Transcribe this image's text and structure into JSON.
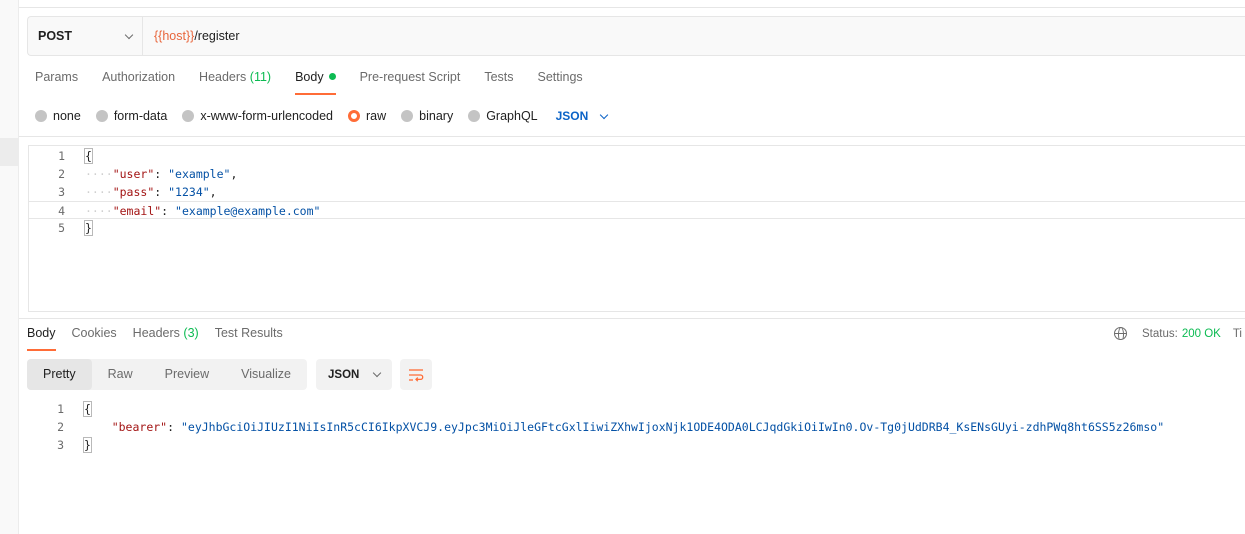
{
  "request": {
    "method": "POST",
    "url_variable": "{{host}}",
    "url_path": "/register",
    "tabs": [
      {
        "label": "Params"
      },
      {
        "label": "Authorization"
      },
      {
        "label": "Headers",
        "count": "(11)"
      },
      {
        "label": "Body"
      },
      {
        "label": "Pre-request Script"
      },
      {
        "label": "Tests"
      },
      {
        "label": "Settings"
      }
    ],
    "body_types": [
      "none",
      "form-data",
      "x-www-form-urlencoded",
      "raw",
      "binary",
      "GraphQL"
    ],
    "selected_body_type": "raw",
    "language": "JSON",
    "lines": {
      "n1": "1",
      "n2": "2",
      "n3": "3",
      "n4": "4",
      "n5": "5",
      "open": "{",
      "close": "}",
      "indent": "····",
      "k1": "\"user\"",
      "v1": "\"example\"",
      "k2": "\"pass\"",
      "v2": "\"1234\"",
      "k3": "\"email\"",
      "v3": "\"example@example.com\"",
      "colon": ":",
      "comma": ","
    }
  },
  "response": {
    "tabs": [
      {
        "label": "Body"
      },
      {
        "label": "Cookies"
      },
      {
        "label": "Headers",
        "count": "(3)"
      },
      {
        "label": "Test Results"
      }
    ],
    "status_label": "Status:",
    "status_value": "200 OK",
    "time_label": "Ti",
    "views": [
      "Pretty",
      "Raw",
      "Preview",
      "Visualize"
    ],
    "format": "JSON",
    "lines": {
      "n1": "1",
      "n2": "2",
      "n3": "3",
      "open": "{",
      "close": "}",
      "k1": "\"bearer\"",
      "v1": "\"eyJhbGciOiJIUzI1NiIsInR5cCI6IkpXVCJ9.eyJpc3MiOiJleGFtcGxlIiwiZXhwIjoxNjk1ODE4ODA0LCJqdGkiOiIwIn0.Ov-Tg0jUdDRB4_KsENsGUyi-zdhPWq8ht6SS5z26mso\"",
      "colon": ":"
    }
  },
  "colors": {
    "accent": "#ff6c37",
    "success": "#0cbb52",
    "link": "#0b63c7",
    "json_key": "#a31515",
    "json_string": "#0451a5"
  },
  "icons": [
    "chevron-down-icon",
    "globe-icon",
    "wrap-lines-icon"
  ]
}
